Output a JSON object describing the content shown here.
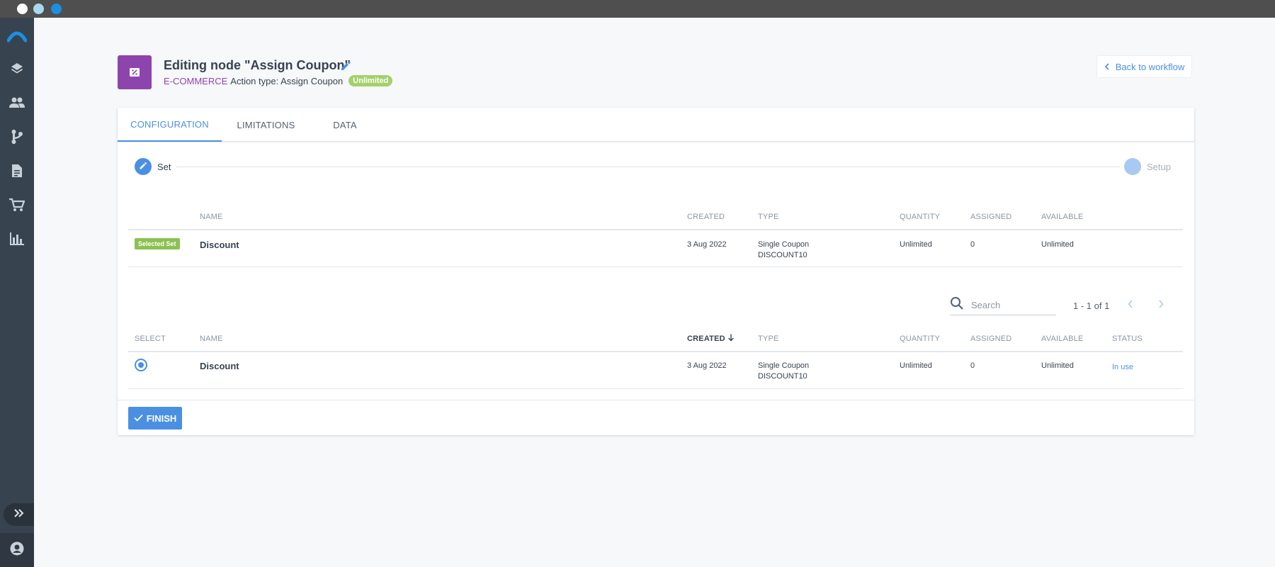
{
  "window": {
    "dot_colors": [
      "#ffffff",
      "#a8d8f0",
      "#1a8fe3"
    ]
  },
  "sidebar": {
    "items": [
      {
        "icon": "logo-icon"
      },
      {
        "icon": "layers-icon"
      },
      {
        "icon": "people-icon"
      },
      {
        "icon": "workflow-icon"
      },
      {
        "icon": "document-icon"
      },
      {
        "icon": "cart-icon"
      },
      {
        "icon": "bar-chart-icon"
      }
    ],
    "expand_icon": "double-chevron-right-icon",
    "user_icon": "account-icon"
  },
  "header": {
    "title": "Editing node \"Assign Coupon\"",
    "category": "E-COMMERCE",
    "action_type": "Action type: Assign Coupon",
    "badge": "Unlimited",
    "back_label": "Back to workflow"
  },
  "tabs": [
    {
      "label": "CONFIGURATION",
      "active": true
    },
    {
      "label": "LIMITATIONS",
      "active": false
    },
    {
      "label": "DATA",
      "active": false
    }
  ],
  "stepper": {
    "steps": [
      {
        "label": "Set",
        "state": "active"
      },
      {
        "label": "Setup",
        "state": "pending"
      }
    ]
  },
  "selected_table": {
    "headers": {
      "name": "NAME",
      "created": "CREATED",
      "type": "TYPE",
      "quantity": "QUANTITY",
      "assigned": "ASSIGNED",
      "available": "AVAILABLE"
    },
    "row": {
      "badge": "Selected Set",
      "name": "Discount",
      "created": "3 Aug 2022",
      "type_line1": "Single Coupon",
      "type_line2": "DISCOUNT10",
      "quantity": "Unlimited",
      "assigned": "0",
      "available": "Unlimited"
    }
  },
  "search": {
    "placeholder": "Search",
    "value": ""
  },
  "pager": {
    "text": "1 - 1 of 1"
  },
  "list_table": {
    "headers": {
      "select": "SELECT",
      "name": "NAME",
      "created": "CREATED",
      "type": "TYPE",
      "quantity": "QUANTITY",
      "assigned": "ASSIGNED",
      "available": "AVAILABLE",
      "status": "STATUS"
    },
    "sort": {
      "column": "created",
      "direction": "desc"
    },
    "rows": [
      {
        "selected": true,
        "name": "Discount",
        "created": "3 Aug 2022",
        "type_line1": "Single Coupon",
        "type_line2": "DISCOUNT10",
        "quantity": "Unlimited",
        "assigned": "0",
        "available": "Unlimited",
        "status": "In use"
      }
    ]
  },
  "footer": {
    "finish_label": "FINISH"
  },
  "colors": {
    "accent": "#4a90e2",
    "category": "#8e44ad",
    "badge_green": "#8cc152",
    "sidebar": "#384350"
  }
}
